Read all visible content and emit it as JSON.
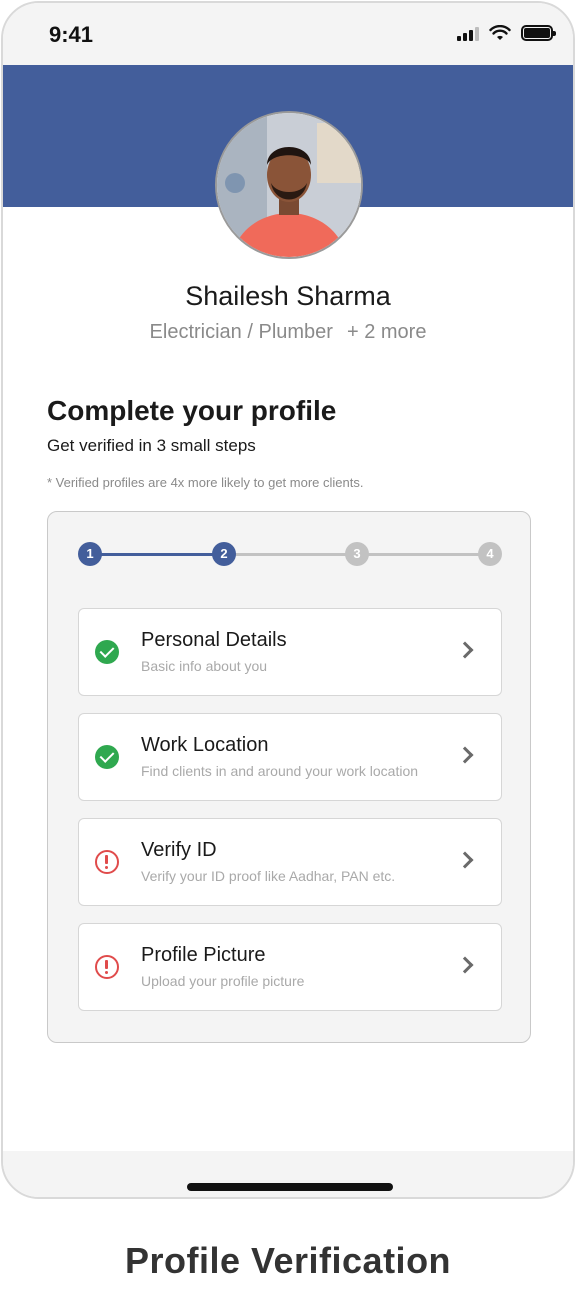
{
  "status_bar": {
    "time": "9:41"
  },
  "profile": {
    "name": "Shailesh Sharma",
    "roles": "Electrician / Plumber",
    "more_roles": "+ 2 more"
  },
  "completion": {
    "title": "Complete your profile",
    "subtitle": "Get verified in 3 small steps",
    "note": "* Verified profiles are 4x more likely to get more clients.",
    "current_step": 2,
    "steps": [
      "1",
      "2",
      "3",
      "4"
    ],
    "tasks": [
      {
        "title": "Personal Details",
        "description": "Basic info about you",
        "status": "complete"
      },
      {
        "title": "Work Location",
        "description": "Find clients in and around your work location",
        "status": "complete"
      },
      {
        "title": "Verify ID",
        "description": "Verify your ID proof like Aadhar, PAN etc.",
        "status": "pending"
      },
      {
        "title": "Profile Picture",
        "description": "Upload your profile picture",
        "status": "pending"
      }
    ]
  },
  "caption": "Profile Verification",
  "colors": {
    "brand": "#435e9b",
    "success": "#2fa84f",
    "warning": "#e04b4b",
    "inactive": "#c2c2c2"
  }
}
